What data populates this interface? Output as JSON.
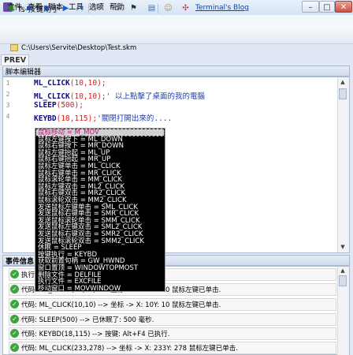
{
  "window": {
    "title": "Ts-按键助手",
    "minimize": "–",
    "maximize": "□",
    "close": "✕"
  },
  "menu": [
    "文件",
    "查看",
    "脚本",
    "工具",
    "选项",
    "帮助"
  ],
  "toolbar": {
    "blog_link": "Terminal's Blog"
  },
  "path": "C:\\Users\\Servite\\Desktop\\Test.skm",
  "prev_tab": "PREV",
  "editor": {
    "title": "脚本编辑器",
    "lines": [
      {
        "num": "1",
        "kw": "ML_CLICK",
        "args": "(10,10);",
        "comment": ""
      },
      {
        "num": "2",
        "kw": "ML_CLICK",
        "args": "(10,10);",
        "comment": "' 以上點擊了桌面的我的電腦"
      },
      {
        "num": "3",
        "kw": "SLEEP",
        "args": "(500);",
        "comment": ""
      },
      {
        "num": "4",
        "kw": "KEYBD",
        "args": "(18,115);",
        "comment": "'關閉打開出來的...."
      }
    ]
  },
  "autocomplete": [
    "鼠标移动 = M_MOV",
    "鼠标左键按下 = ML_DOWN",
    "鼠标右键按下 = MR_DOWN",
    "鼠标左键抬起 = ML_UP",
    "鼠标右键抬起 = MR_UP",
    "鼠标左键单击 = ML_CLICK",
    "鼠标右键单击 = MR_CLICK",
    "鼠标滚轮单击 = MM_CLICK",
    "鼠标左键双击 = ML2_CLICK",
    "鼠标右键双击 = MR2_CLICK",
    "鼠标滚轮双击 = MM2_CLICK",
    "发送鼠标左键单击 = SML_CLICK",
    "发送鼠标右键单击 = SMR_CLICK",
    "发送鼠标滚轮单击 = SMM_CLICK",
    "发送鼠标左键双击 = SML2_CLICK",
    "发送鼠标右键双击 = SMR2_CLICK",
    "发送鼠标滚轮双击 = SMM2_CLICK",
    "休眠 = SLEEP",
    "按键执行 = KEYBD",
    "获取前置句柄 = GW_HWND",
    "窗口置顶 = WINDOWTOPMOST",
    "删除文件 = DELFILE",
    "执行文件 = EXCFILE",
    "移动窗口 = MOVWINDOW"
  ],
  "events": {
    "title": "事件信息",
    "items": [
      "执行...",
      "代码: ML_CLICK(10,10) --> 坐标 -> X: 10Y: 10 鼠标左键已单击.",
      "代码: ML_CLICK(10,10) --> 坐标 -> X: 10Y: 10 鼠标左键已单击.",
      "代码: SLEEP(500) --> 已休眠了: 500 毫秒.",
      "代码: KEYBD(18,115) --> 按键: Alt+F4 已执行.",
      "代码: ML_CLICK(233,278) --> 坐标 -> X: 233Y: 278 鼠标左键已单击."
    ]
  }
}
